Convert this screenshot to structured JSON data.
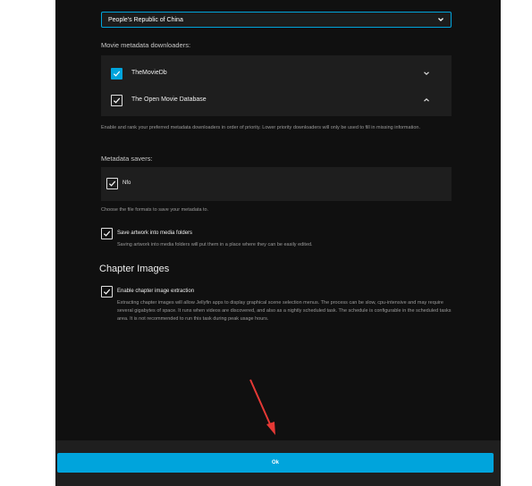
{
  "country_select": {
    "value": "People's Republic of China"
  },
  "downloaders": {
    "label": "Movie metadata downloaders:",
    "items": [
      {
        "label": "TheMovieDb",
        "checked": true
      },
      {
        "label": "The Open Movie Database",
        "checked": true
      }
    ],
    "help": "Enable and rank your preferred metadata downloaders in order of priority. Lower priority downloaders will only be used to fill in missing information."
  },
  "savers": {
    "label": "Metadata savers:",
    "items": [
      {
        "label": "Nfo",
        "checked": true
      }
    ],
    "help": "Choose the file formats to save your metadata to."
  },
  "artwork": {
    "label": "Save artwork into media folders",
    "checked": true,
    "help": "Saving artwork into media folders will put them in a place where they can be easily edited."
  },
  "chapters": {
    "heading": "Chapter Images",
    "label": "Enable chapter image extraction",
    "checked": true,
    "help": "Extracting chapter images will allow Jellyfin apps to display graphical scene selection menus. The process can be slow, cpu-intensive and may require several gigabytes of space. It runs when videos are discovered, and also as a nightly scheduled task. The schedule is configurable in the scheduled tasks area. It is not recommended to run this task during peak usage hours."
  },
  "footer": {
    "ok_label": "Ok"
  },
  "colors": {
    "accent": "#00a4dc",
    "background": "#101010",
    "panel": "#1e1e1e",
    "annotation_arrow": "#e53935"
  }
}
